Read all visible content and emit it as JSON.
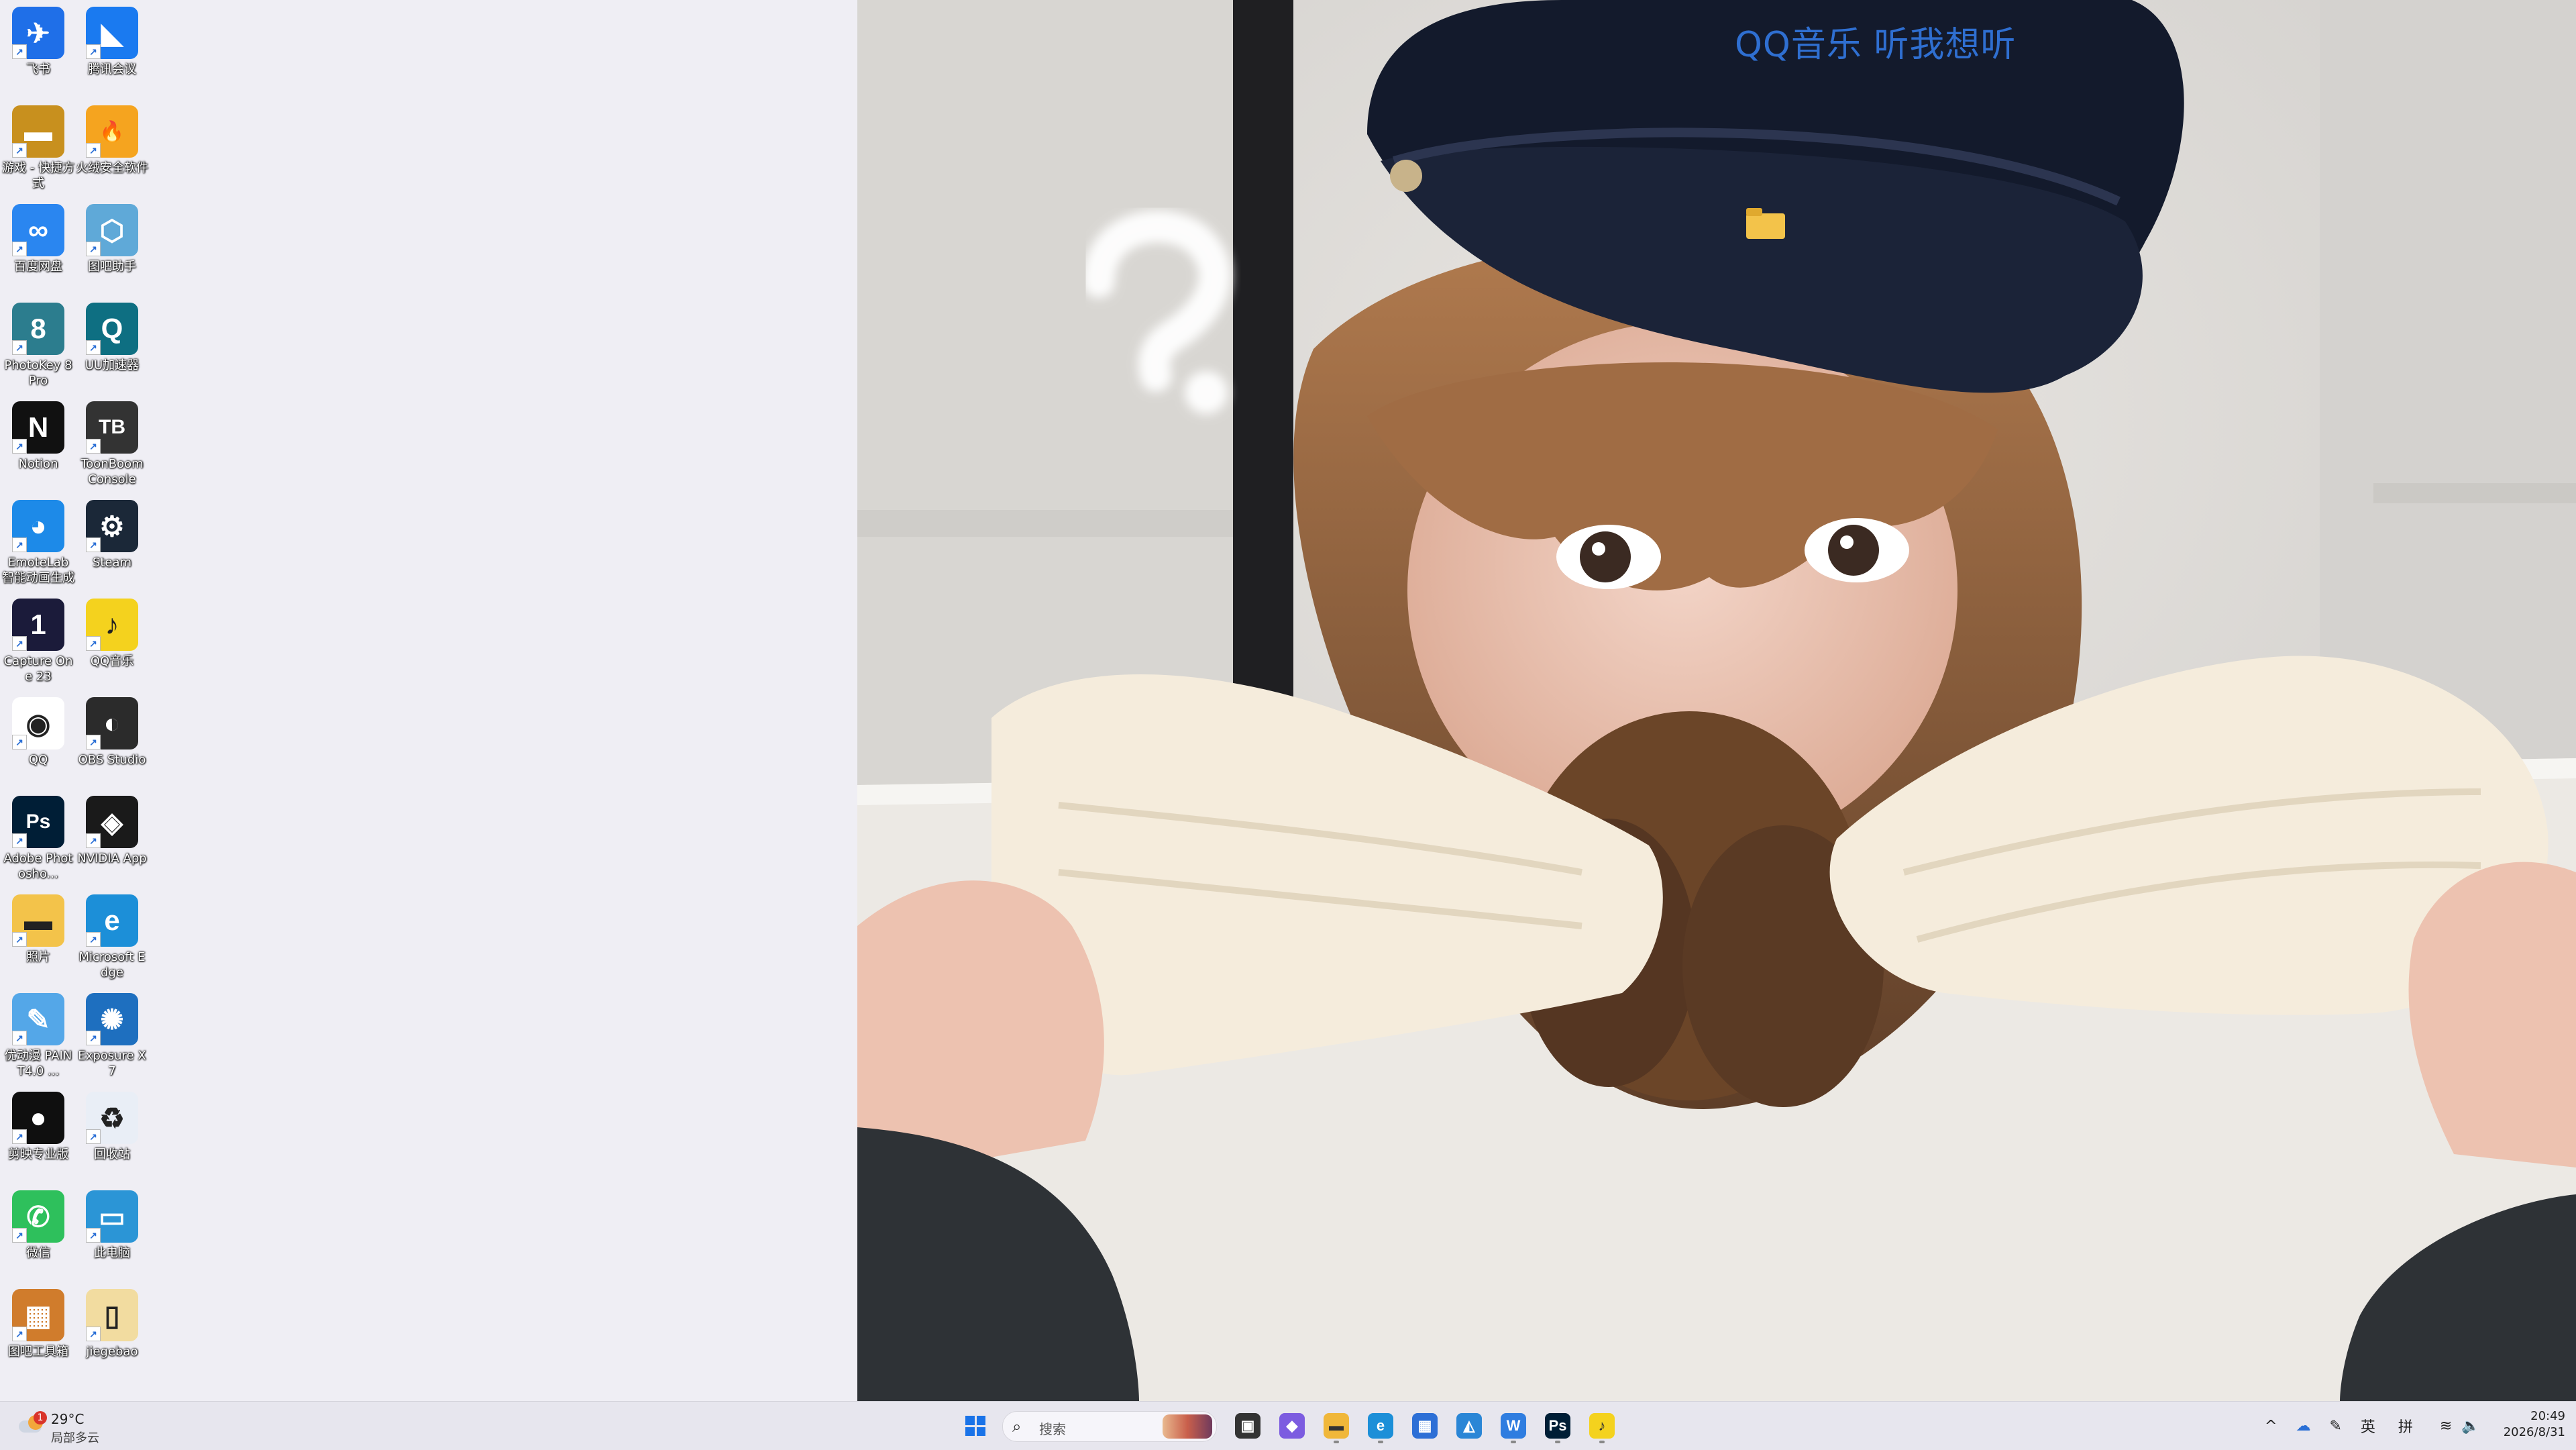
{
  "desktop": {
    "icons": [
      {
        "label": "飞书",
        "glyph": "✈",
        "color": "#1f6fe8",
        "icon": "feishu-icon",
        "col": 0,
        "row": 0
      },
      {
        "label": "腾讯会议",
        "glyph": "◣",
        "color": "#1a7af0",
        "icon": "tencent-meeting-icon",
        "col": 1,
        "row": 0
      },
      {
        "label": "游戏 - 快捷方式",
        "glyph": "▬",
        "color": "#c8901e",
        "icon": "folder-games-icon",
        "col": 0,
        "row": 1
      },
      {
        "label": "火绒安全软件",
        "glyph": "🔥",
        "color": "#f5a41f",
        "icon": "huorong-icon",
        "col": 1,
        "row": 1
      },
      {
        "label": "百度网盘",
        "glyph": "∞",
        "color": "#2a86f0",
        "icon": "baidu-netdisk-icon",
        "col": 0,
        "row": 2
      },
      {
        "label": "图吧助手",
        "glyph": "⬡",
        "color": "#5fa9d8",
        "icon": "tuba-assistant-icon",
        "col": 1,
        "row": 2
      },
      {
        "label": "PhotoKey 8 Pro",
        "glyph": "8",
        "color": "#2c7d8e",
        "icon": "photokey-icon",
        "col": 0,
        "row": 3
      },
      {
        "label": "UU加速器",
        "glyph": "Q",
        "color": "#0e6f82",
        "icon": "uu-accelerator-icon",
        "col": 1,
        "row": 3
      },
      {
        "label": "Notion",
        "glyph": "N",
        "color": "#111111",
        "icon": "notion-icon",
        "col": 0,
        "row": 4
      },
      {
        "label": "ToonBoom Console",
        "glyph": "TB",
        "color": "#333333",
        "icon": "toonbox-icon",
        "col": 1,
        "row": 4
      },
      {
        "label": "EmoteLab 智能动画生成",
        "glyph": "◕",
        "color": "#1d8ae8",
        "icon": "emotelab-icon",
        "col": 0,
        "row": 5
      },
      {
        "label": "Steam",
        "glyph": "⚙",
        "color": "#1b2838",
        "icon": "steam-icon",
        "col": 1,
        "row": 5
      },
      {
        "label": "Capture One 23",
        "glyph": "1",
        "color": "#1b1b3a",
        "icon": "capture-one-icon",
        "col": 0,
        "row": 6
      },
      {
        "label": "QQ音乐",
        "glyph": "♪",
        "color": "#f4d21e",
        "icon": "qq-music-icon",
        "col": 1,
        "row": 6
      },
      {
        "label": "QQ",
        "glyph": "◉",
        "color": "#ffffff",
        "icon": "qq-penguin-icon",
        "col": 0,
        "row": 7
      },
      {
        "label": "OBS Studio",
        "glyph": "◐",
        "color": "#2b2b2b",
        "icon": "obs-icon",
        "col": 1,
        "row": 7
      },
      {
        "label": "Adobe Photosho...",
        "glyph": "Ps",
        "color": "#001e36",
        "icon": "photoshop-icon",
        "col": 0,
        "row": 8
      },
      {
        "label": "NVIDIA App",
        "glyph": "◈",
        "color": "#1a1a1a",
        "icon": "nvidia-icon",
        "col": 1,
        "row": 8
      },
      {
        "label": "照片",
        "glyph": "▬",
        "color": "#f3c34a",
        "icon": "folder-icon",
        "col": 0,
        "row": 9
      },
      {
        "label": "Microsoft Edge",
        "glyph": "e",
        "color": "#1c8fd8",
        "icon": "edge-icon",
        "col": 1,
        "row": 9
      },
      {
        "label": "优动漫 PAINT4.0 ...",
        "glyph": "✎",
        "color": "#54a7e8",
        "icon": "paint-icon",
        "col": 0,
        "row": 10
      },
      {
        "label": "Exposure X7",
        "glyph": "✺",
        "color": "#1e6fbf",
        "icon": "exposure-icon",
        "col": 1,
        "row": 10
      },
      {
        "label": "剪映专业版",
        "glyph": "●",
        "color": "#0f0f0f",
        "icon": "jianying-icon",
        "col": 0,
        "row": 11
      },
      {
        "label": "回收站",
        "glyph": "♻",
        "color": "#e9eef6",
        "icon": "recycle-bin-icon",
        "col": 1,
        "row": 11
      },
      {
        "label": "微信",
        "glyph": "✆",
        "color": "#2ec05c",
        "icon": "wechat-icon",
        "col": 0,
        "row": 12
      },
      {
        "label": "此电脑",
        "glyph": "▭",
        "color": "#2b95d6",
        "icon": "this-pc-icon",
        "col": 1,
        "row": 12
      },
      {
        "label": "图吧工具箱",
        "glyph": "▦",
        "color": "#d07c2c",
        "icon": "tuba-toolbox-icon",
        "col": 0,
        "row": 13
      },
      {
        "label": "jiegebao",
        "glyph": "▯",
        "color": "#f2dca0",
        "icon": "jiegebao-icon",
        "col": 1,
        "row": 13
      }
    ]
  },
  "wallpaper": {
    "caption": "QQ音乐 听我想听"
  },
  "taskbar": {
    "weather": {
      "temp": "29°C",
      "desc": "局部多云",
      "badge": "1"
    },
    "search_placeholder": "搜索",
    "apps": [
      {
        "name": "start-button",
        "glyph": "⊞",
        "color": "#1a73e8"
      },
      {
        "name": "task-view-button",
        "glyph": "▣",
        "color": "#333333"
      },
      {
        "name": "copilot-app",
        "glyph": "◆",
        "color": "#7c5ce0"
      },
      {
        "name": "file-explorer-app",
        "glyph": "▬",
        "color": "#f0b73a"
      },
      {
        "name": "edge-app",
        "glyph": "e",
        "color": "#1c8fd8"
      },
      {
        "name": "store-app",
        "glyph": "▦",
        "color": "#2d6fd6"
      },
      {
        "name": "photos-app",
        "glyph": "◭",
        "color": "#2a86d6"
      },
      {
        "name": "wps-app",
        "glyph": "W",
        "color": "#2f7de0"
      },
      {
        "name": "photoshop-app",
        "glyph": "Ps",
        "color": "#001e36"
      },
      {
        "name": "qq-music-app",
        "glyph": "♪",
        "color": "#f4d21e"
      }
    ],
    "tray": {
      "ime_lang": "英",
      "ime_mode": "拼",
      "time": "20:49",
      "date": "2026/8/31"
    }
  }
}
